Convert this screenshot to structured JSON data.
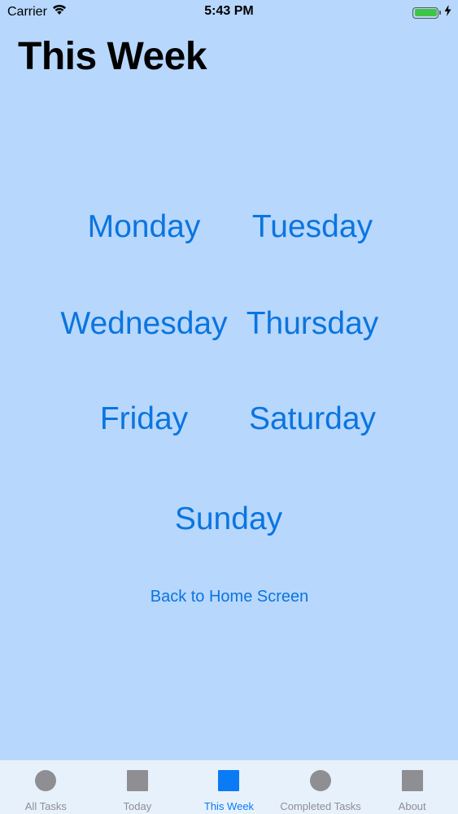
{
  "status_bar": {
    "carrier": "Carrier",
    "time": "5:43 PM",
    "icons": [
      "wifi-icon",
      "battery-icon",
      "charging-bolt-icon"
    ],
    "battery_color": "#3fc545"
  },
  "header": {
    "title": "This Week"
  },
  "days": {
    "monday": "Monday",
    "tuesday": "Tuesday",
    "wednesday": "Wednesday",
    "thursday": "Thursday",
    "friday": "Friday",
    "saturday": "Saturday",
    "sunday": "Sunday"
  },
  "back_link": "Back to Home Screen",
  "tab_bar": {
    "tabs": [
      {
        "label": "All Tasks",
        "icon": "circle-icon"
      },
      {
        "label": "Today",
        "icon": "square-icon"
      },
      {
        "label": "This Week",
        "icon": "square-icon",
        "active": true
      },
      {
        "label": "Completed Tasks",
        "icon": "circle-icon"
      },
      {
        "label": "About",
        "icon": "square-icon"
      }
    ]
  },
  "colors": {
    "background": "#b8d7fd",
    "accent": "#0a75df",
    "tab_active": "#0a7bf5",
    "tab_inactive": "#8e8e93"
  }
}
